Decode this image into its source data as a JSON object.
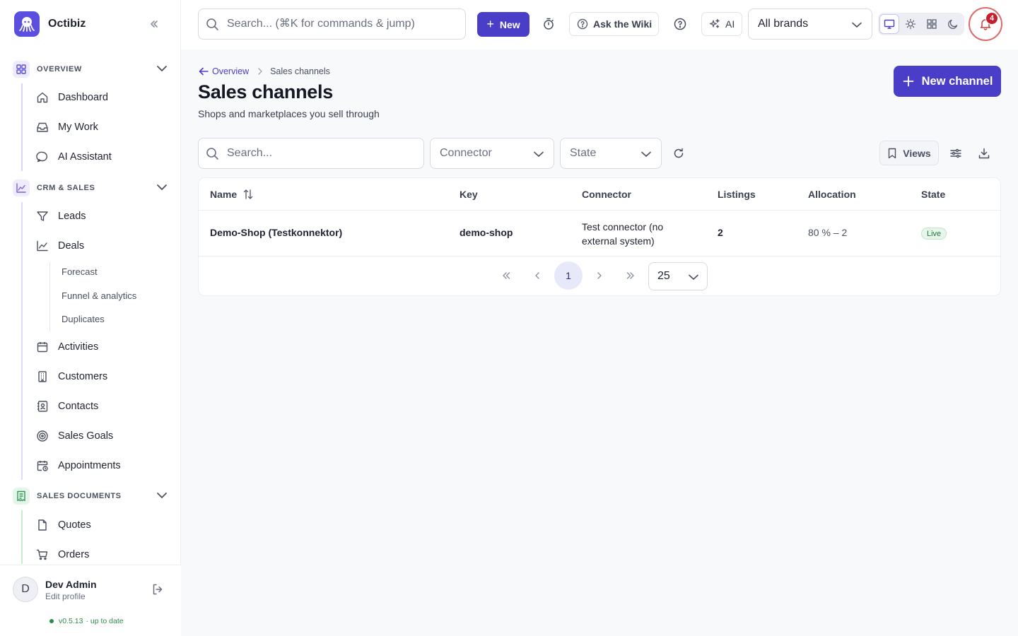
{
  "app": {
    "name": "Octibiz"
  },
  "topbar": {
    "search_placeholder": "Search... (⌘K for commands & jump)",
    "new_label": "New",
    "wiki_label": "Ask the Wiki",
    "ai_label": "AI",
    "brand_select": "All brands",
    "notification_count": "4"
  },
  "sidebar": {
    "groups": [
      {
        "label": "OVERVIEW",
        "color": "#5b4fe0",
        "items": [
          "Dashboard",
          "My Work",
          "AI Assistant"
        ]
      },
      {
        "label": "CRM & SALES",
        "color": "#7a5fe0",
        "items": [
          "Leads",
          "Deals",
          "Activities",
          "Customers",
          "Contacts",
          "Sales Goals",
          "Appointments"
        ],
        "deal_subitems": [
          "Forecast",
          "Funnel & analytics",
          "Duplicates"
        ]
      },
      {
        "label": "SALES DOCUMENTS",
        "color": "#2f9a55",
        "items": [
          "Quotes",
          "Orders"
        ]
      }
    ],
    "user": {
      "initial": "D",
      "name": "Dev Admin",
      "sub": "Edit profile"
    },
    "version": "v0.5.13",
    "version_status": "· up to date"
  },
  "page": {
    "breadcrumb": {
      "back": "Overview",
      "current": "Sales channels"
    },
    "title": "Sales channels",
    "subtitle": "Shops and marketplaces you sell through",
    "primary_button": "New channel"
  },
  "filters": {
    "search_placeholder": "Search...",
    "connector": "Connector",
    "state": "State",
    "views": "Views"
  },
  "table": {
    "columns": [
      "Name",
      "Key",
      "Connector",
      "Listings",
      "Allocation",
      "State"
    ],
    "rows": [
      {
        "name": "Demo-Shop (Testkonnektor)",
        "key": "demo-shop",
        "connector_line1": "Test connector (no",
        "connector_line2": "external system)",
        "listings": "2",
        "allocation": "80 % – 2",
        "state": "Live"
      }
    ]
  },
  "pagination": {
    "current_page": "1",
    "page_size": "25"
  }
}
